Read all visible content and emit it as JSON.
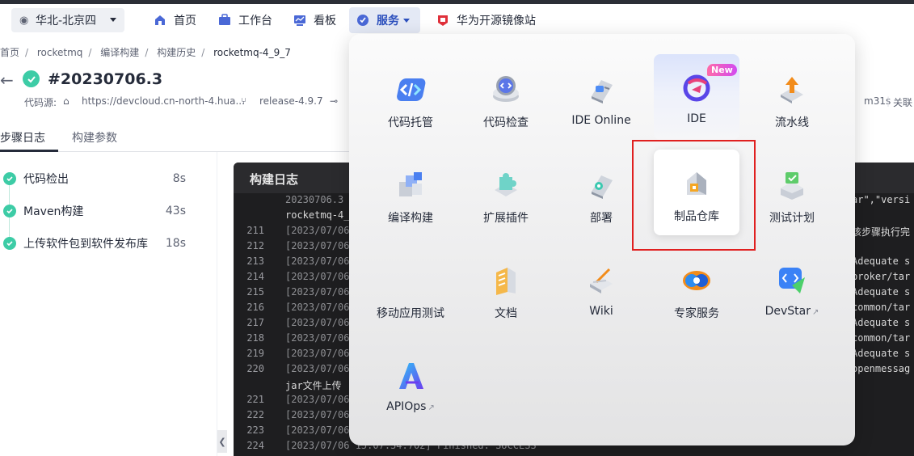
{
  "nav": {
    "region": "华北-北京四",
    "items": [
      {
        "label": "首页",
        "icon": "home-icon"
      },
      {
        "label": "工作台",
        "icon": "workbench-icon"
      },
      {
        "label": "看板",
        "icon": "dashboard-icon"
      },
      {
        "label": "服务",
        "icon": "service-icon",
        "active": true
      },
      {
        "label": "华为开源镜像站",
        "icon": "mirror-icon"
      }
    ]
  },
  "breadcrumb": [
    "首页",
    "rocketmq",
    "编译构建",
    "构建历史",
    "rocketmq-4_9_7"
  ],
  "build": {
    "number": "#20230706.3",
    "source_label": "代码源:",
    "source_url": "https://devcloud.cn-north-4.hua...",
    "branch": "release-4.9.7",
    "duration_tail": "m31s",
    "related": "关联"
  },
  "tabs": [
    "步骤日志",
    "构建参数"
  ],
  "steps": [
    {
      "name": "代码检出",
      "duration": "8s"
    },
    {
      "name": "Maven构建",
      "duration": "43s"
    },
    {
      "name": "上传软件包到软件发布库",
      "duration": "18s"
    }
  ],
  "console": {
    "title": "构建日志",
    "partial_top": "20230706.3",
    "partial_top_right": "ar\",\"versi",
    "wrap_line_1": "rocketmq-4_",
    "right_msg_1": "该步骤执行完",
    "lines": [
      {
        "num": "211",
        "text": "[2023/07/06",
        "right": ""
      },
      {
        "num": "212",
        "text": "[2023/07/06",
        "right": ""
      },
      {
        "num": "213",
        "text": "[2023/07/06",
        "right": "Adequate s"
      },
      {
        "num": "214",
        "text": "[2023/07/06",
        "right": "broker/tar"
      },
      {
        "num": "215",
        "text": "[2023/07/06",
        "right": "Adequate s"
      },
      {
        "num": "216",
        "text": "[2023/07/06",
        "right": "common/tar"
      },
      {
        "num": "217",
        "text": "[2023/07/06",
        "right": "Adequate s"
      },
      {
        "num": "218",
        "text": "[2023/07/06",
        "right": "common/tar"
      },
      {
        "num": "219",
        "text": "[2023/07/06",
        "right": "Adequate s"
      },
      {
        "num": "220",
        "text": "[2023/07/06",
        "right": "openmessag"
      }
    ],
    "wrap_line_2": "jar文件上传",
    "lines2": [
      {
        "num": "221",
        "text": "[2023/07/06"
      },
      {
        "num": "222",
        "text": "[2023/07/06"
      },
      {
        "num": "223",
        "text": "[2023/07/06"
      },
      {
        "num": "224",
        "text": "[2023/07/06 15:07:34.702] Finished: SUCCESS"
      }
    ]
  },
  "services": {
    "new_badge": "New",
    "items": [
      {
        "label": "代码托管",
        "icon": "code-hosting-icon"
      },
      {
        "label": "代码检查",
        "icon": "code-check-icon"
      },
      {
        "label": "IDE Online",
        "icon": "ide-online-icon"
      },
      {
        "label": "IDE",
        "icon": "ide-icon"
      },
      {
        "label": "流水线",
        "icon": "pipeline-icon"
      },
      {
        "label": "编译构建",
        "icon": "build-icon"
      },
      {
        "label": "扩展插件",
        "icon": "plugin-icon"
      },
      {
        "label": "部署",
        "icon": "deploy-icon"
      },
      {
        "label": "制品仓库",
        "icon": "artifact-repo-icon"
      },
      {
        "label": "测试计划",
        "icon": "test-plan-icon"
      },
      {
        "label": "移动应用测试",
        "icon": "mobile-test-icon"
      },
      {
        "label": "文档",
        "icon": "docs-icon"
      },
      {
        "label": "Wiki",
        "icon": "wiki-icon"
      },
      {
        "label": "专家服务",
        "icon": "expert-icon"
      },
      {
        "label": "DevStar",
        "icon": "devstar-icon"
      },
      {
        "label": "APIOps",
        "icon": "apiops-icon"
      }
    ]
  },
  "colors": {
    "accent": "#2b4fbd",
    "success": "#3dcca6",
    "highlight_box": "#e02020"
  }
}
